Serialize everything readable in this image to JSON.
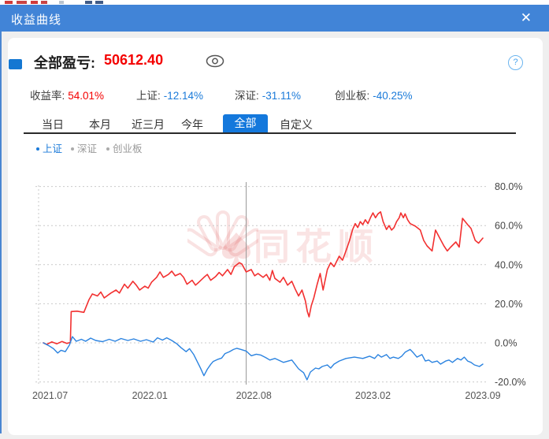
{
  "window": {
    "title": "收益曲线",
    "close_glyph": "✕"
  },
  "header": {
    "label": "全部盈亏:",
    "value": "50612.40",
    "help_glyph": "?"
  },
  "stats": [
    {
      "label": "收益率:",
      "value": "54.01%",
      "tone": "red"
    },
    {
      "label": "上证:",
      "value": "-12.14%",
      "tone": "blue"
    },
    {
      "label": "深证:",
      "value": "-31.11%",
      "tone": "blue"
    },
    {
      "label": "创业板:",
      "value": "-40.25%",
      "tone": "blue"
    }
  ],
  "tabs": [
    {
      "label": "当日",
      "active": false
    },
    {
      "label": "本月",
      "active": false
    },
    {
      "label": "近三月",
      "active": false
    },
    {
      "label": "今年",
      "active": false
    },
    {
      "label": "全部",
      "active": true
    },
    {
      "label": "自定义",
      "active": false
    }
  ],
  "legend": [
    {
      "label": "上证",
      "active": true
    },
    {
      "label": "深证",
      "active": false
    },
    {
      "label": "创业板",
      "active": false
    }
  ],
  "watermark": "同花顺",
  "colors": {
    "accent_blue": "#1a7ad9",
    "titlebar_blue": "#4184d7",
    "value_red": "#f40000",
    "line_red": "#f23030",
    "line_blue": "#2b83e0",
    "grid": "#c9c9c9",
    "cursor": "#999999"
  },
  "chart_data": {
    "type": "line",
    "x_range": [
      "2021.07",
      "2023.09"
    ],
    "ylim": [
      -25,
      85
    ],
    "grid": true,
    "cursor_month": 12.0,
    "yticks": [
      {
        "v": 80,
        "label": "80.0%"
      },
      {
        "v": 60,
        "label": "60.0%"
      },
      {
        "v": 40,
        "label": "40.0%"
      },
      {
        "v": 20,
        "label": "20.0%"
      },
      {
        "v": 0,
        "label": "0.0%"
      },
      {
        "v": -20,
        "label": "-20.0%"
      }
    ],
    "xticks": [
      {
        "m": 0.4,
        "label": "2021.07"
      },
      {
        "m": 6.3,
        "label": "2022.01"
      },
      {
        "m": 12.45,
        "label": "2022.08"
      },
      {
        "m": 19.5,
        "label": "2023.02"
      },
      {
        "m": 26,
        "label": "2023.09"
      }
    ],
    "series": [
      {
        "name": "收益率",
        "color": "#f23030",
        "width": 1.6,
        "points": [
          [
            0,
            0
          ],
          [
            0.2,
            -0.8
          ],
          [
            0.5,
            0.5
          ],
          [
            0.8,
            -0.5
          ],
          [
            1.1,
            0.7
          ],
          [
            1.4,
            -0.3
          ],
          [
            1.6,
            0.2
          ],
          [
            1.65,
            16
          ],
          [
            2.0,
            16.2
          ],
          [
            2.4,
            15.6
          ],
          [
            2.7,
            22
          ],
          [
            2.9,
            25
          ],
          [
            3.2,
            24
          ],
          [
            3.4,
            26
          ],
          [
            3.6,
            23
          ],
          [
            4.0,
            25.5
          ],
          [
            4.3,
            27
          ],
          [
            4.5,
            25.5
          ],
          [
            4.8,
            30
          ],
          [
            5.0,
            28
          ],
          [
            5.3,
            31.5
          ],
          [
            5.5,
            29.5
          ],
          [
            5.7,
            27
          ],
          [
            6.0,
            29
          ],
          [
            6.2,
            28
          ],
          [
            6.4,
            31
          ],
          [
            6.7,
            33.5
          ],
          [
            6.9,
            36.3
          ],
          [
            7.1,
            33.5
          ],
          [
            7.4,
            35
          ],
          [
            7.6,
            36.7
          ],
          [
            7.8,
            34.3
          ],
          [
            8.1,
            35.5
          ],
          [
            8.3,
            33.5
          ],
          [
            8.5,
            30
          ],
          [
            8.8,
            32
          ],
          [
            9.0,
            29.5
          ],
          [
            9.2,
            31
          ],
          [
            9.5,
            33.5
          ],
          [
            9.7,
            35
          ],
          [
            9.9,
            32
          ],
          [
            10.2,
            34
          ],
          [
            10.4,
            36
          ],
          [
            10.6,
            34.3
          ],
          [
            10.9,
            37.5
          ],
          [
            11.1,
            35
          ],
          [
            11.3,
            39
          ],
          [
            11.6,
            41
          ],
          [
            11.75,
            40.3
          ],
          [
            12.0,
            36.3
          ],
          [
            12.3,
            37.5
          ],
          [
            12.5,
            34.3
          ],
          [
            12.7,
            35.5
          ],
          [
            13.0,
            33.5
          ],
          [
            13.2,
            35
          ],
          [
            13.4,
            32
          ],
          [
            13.55,
            37
          ],
          [
            13.7,
            33
          ],
          [
            14.0,
            31
          ],
          [
            14.2,
            33.5
          ],
          [
            14.45,
            29.5
          ],
          [
            14.7,
            31.5
          ],
          [
            14.9,
            27.5
          ],
          [
            15.1,
            24
          ],
          [
            15.3,
            27
          ],
          [
            15.5,
            21.5
          ],
          [
            15.62,
            16
          ],
          [
            15.72,
            13.3
          ],
          [
            15.85,
            19
          ],
          [
            16.0,
            23
          ],
          [
            16.2,
            30
          ],
          [
            16.38,
            35.5
          ],
          [
            16.55,
            27
          ],
          [
            16.8,
            37.5
          ],
          [
            17.0,
            41
          ],
          [
            17.2,
            39
          ],
          [
            17.5,
            44.3
          ],
          [
            17.7,
            42.3
          ],
          [
            17.9,
            47
          ],
          [
            18.1,
            52
          ],
          [
            18.3,
            58
          ],
          [
            18.45,
            61
          ],
          [
            18.6,
            59
          ],
          [
            18.75,
            62
          ],
          [
            18.9,
            60.5
          ],
          [
            19.05,
            63
          ],
          [
            19.2,
            61
          ],
          [
            19.35,
            64
          ],
          [
            19.5,
            66.5
          ],
          [
            19.65,
            64
          ],
          [
            19.8,
            66
          ],
          [
            19.95,
            67
          ],
          [
            20.1,
            62
          ],
          [
            20.3,
            58
          ],
          [
            20.45,
            60
          ],
          [
            20.6,
            57.7
          ],
          [
            20.75,
            59
          ],
          [
            20.9,
            62
          ],
          [
            21.05,
            64
          ],
          [
            21.15,
            66.5
          ],
          [
            21.3,
            64
          ],
          [
            21.4,
            66
          ],
          [
            21.55,
            63
          ],
          [
            21.7,
            61
          ],
          [
            22.0,
            59.7
          ],
          [
            22.3,
            57.7
          ],
          [
            22.5,
            52.4
          ],
          [
            22.7,
            49.6
          ],
          [
            23.0,
            47
          ],
          [
            23.2,
            57.7
          ],
          [
            23.45,
            53.6
          ],
          [
            23.7,
            49.6
          ],
          [
            23.9,
            47
          ],
          [
            24.1,
            49
          ],
          [
            24.4,
            51.6
          ],
          [
            24.6,
            49
          ],
          [
            24.8,
            63.7
          ],
          [
            25.1,
            60.5
          ],
          [
            25.3,
            58.5
          ],
          [
            25.55,
            52.4
          ],
          [
            25.75,
            51
          ],
          [
            26,
            53.6
          ]
        ]
      },
      {
        "name": "上证",
        "color": "#2b83e0",
        "width": 1.4,
        "points": [
          [
            0,
            0
          ],
          [
            0.33,
            -1.5
          ],
          [
            0.6,
            -3
          ],
          [
            0.85,
            -5.2
          ],
          [
            1.05,
            -3.8
          ],
          [
            1.3,
            -4.5
          ],
          [
            1.55,
            -1
          ],
          [
            1.72,
            3.2
          ],
          [
            1.95,
            0.8
          ],
          [
            2.25,
            1.8
          ],
          [
            2.5,
            0.8
          ],
          [
            2.8,
            2.4
          ],
          [
            3.1,
            1.2
          ],
          [
            3.5,
            0.6
          ],
          [
            3.9,
            1.8
          ],
          [
            4.25,
            0.8
          ],
          [
            4.6,
            2.2
          ],
          [
            5.0,
            1.2
          ],
          [
            5.35,
            2.0
          ],
          [
            5.75,
            0.8
          ],
          [
            6.1,
            1.6
          ],
          [
            6.5,
            0.4
          ],
          [
            6.75,
            2.6
          ],
          [
            7.05,
            1.4
          ],
          [
            7.3,
            2.6
          ],
          [
            7.6,
            1.2
          ],
          [
            7.9,
            -0.5
          ],
          [
            8.15,
            -2.5
          ],
          [
            8.45,
            -4.5
          ],
          [
            8.65,
            -3
          ],
          [
            8.9,
            -6
          ],
          [
            9.1,
            -9.5
          ],
          [
            9.3,
            -13
          ],
          [
            9.5,
            -16.8
          ],
          [
            9.7,
            -13.5
          ],
          [
            9.9,
            -11
          ],
          [
            10.05,
            -9.5
          ],
          [
            10.3,
            -8.5
          ],
          [
            10.55,
            -7.8
          ],
          [
            10.75,
            -5.5
          ],
          [
            11.0,
            -4.6
          ],
          [
            11.25,
            -3.4
          ],
          [
            11.45,
            -2.8
          ],
          [
            11.7,
            -3.4
          ],
          [
            12.0,
            -4.2
          ],
          [
            12.3,
            -6.6
          ],
          [
            12.6,
            -5.8
          ],
          [
            12.85,
            -6.2
          ],
          [
            13.15,
            -7.5
          ],
          [
            13.4,
            -8.8
          ],
          [
            13.7,
            -8.0
          ],
          [
            14.2,
            -10
          ],
          [
            14.7,
            -8.8
          ],
          [
            15.1,
            -13.3
          ],
          [
            15.4,
            -15.3
          ],
          [
            15.6,
            -18.9
          ],
          [
            15.8,
            -14.9
          ],
          [
            16.1,
            -12.9
          ],
          [
            16.3,
            -13.3
          ],
          [
            16.5,
            -12.1
          ],
          [
            16.8,
            -11.3
          ],
          [
            17.0,
            -12.9
          ],
          [
            17.2,
            -10.9
          ],
          [
            17.5,
            -9.3
          ],
          [
            17.9,
            -8
          ],
          [
            18.4,
            -7.3
          ],
          [
            18.9,
            -8
          ],
          [
            19.3,
            -6.8
          ],
          [
            19.6,
            -8
          ],
          [
            19.8,
            -6
          ],
          [
            20.0,
            -7.3
          ],
          [
            20.3,
            -6
          ],
          [
            20.5,
            -8
          ],
          [
            20.7,
            -7.3
          ],
          [
            21.0,
            -8
          ],
          [
            21.2,
            -6.8
          ],
          [
            21.4,
            -4.8
          ],
          [
            21.7,
            -3.4
          ],
          [
            21.9,
            -5.2
          ],
          [
            22.1,
            -7.3
          ],
          [
            22.4,
            -6
          ],
          [
            22.6,
            -9.3
          ],
          [
            22.8,
            -8.8
          ],
          [
            23.0,
            -10
          ],
          [
            23.3,
            -9.3
          ],
          [
            23.5,
            -10.9
          ],
          [
            23.8,
            -9.3
          ],
          [
            24.0,
            -8.8
          ],
          [
            24.2,
            -10
          ],
          [
            24.5,
            -8
          ],
          [
            24.7,
            -8.8
          ],
          [
            24.9,
            -7.3
          ],
          [
            25.1,
            -9.3
          ],
          [
            25.3,
            -10
          ],
          [
            25.5,
            -11.3
          ],
          [
            25.8,
            -12.1
          ],
          [
            26,
            -10.9
          ]
        ]
      }
    ]
  }
}
